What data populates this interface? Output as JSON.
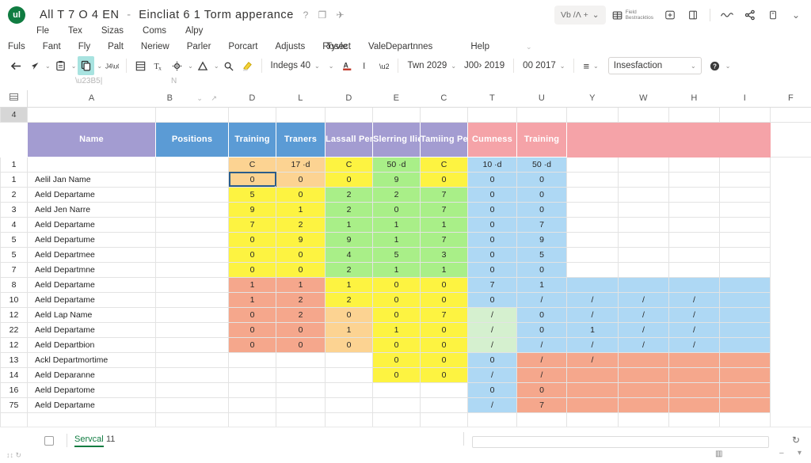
{
  "titlebar": {
    "logo_text": "ul",
    "doc_title_main": "All T 7 O 4 EN",
    "separator": "-",
    "doc_title_sub": "Eincliat 6 1 Torm apperance",
    "title_mini_1": "?",
    "title_mini_2": "❐",
    "title_mini_3": "✈",
    "right": {
      "pill_label": "Vb /Ʌ +",
      "pill_caret": "⌄",
      "field_label_line1": "Field",
      "field_label_line2": "Bestracktios",
      "share_label": "",
      "collapse_caret": "⌄"
    }
  },
  "menu": {
    "row_a": [
      "Fle",
      "Tex",
      "Sizas",
      "Coms",
      "Alpy"
    ],
    "row_b": [
      "Fuls",
      "Fant",
      "Fly",
      "Palt",
      "Neriew",
      "Parler",
      "Porcart",
      "Adjusts",
      "Rosect",
      "Vale"
    ],
    "row_c": [
      "Tyvle",
      "Departnnes",
      "Help"
    ],
    "row_c_caret": "⌄"
  },
  "ribbon": {
    "indent_label": "Indegs 40",
    "font_label": "Twn 2029",
    "font_size_label": "J00› 2019",
    "number_label": "00 2017",
    "style_value": "Insesfaction",
    "caret": "⌄",
    "dropdown_caret": "⌄",
    "align_icon": "≡",
    "help_icon": "?"
  },
  "grid": {
    "columns": [
      "A",
      "B",
      "D",
      "L",
      "D",
      "E",
      "C",
      "T",
      "U",
      "Y",
      "W",
      "H",
      "I",
      "F"
    ],
    "selected_row_gutter": "4",
    "banner": [
      {
        "label": "Name",
        "fill": "bn-purple"
      },
      {
        "label": "Positions",
        "fill": "bn-blue"
      },
      {
        "label": "Training",
        "fill": "bn-blue"
      },
      {
        "label": "Traners",
        "fill": "bn-blue"
      },
      {
        "label": "Lassall Period",
        "fill": "bn-purple"
      },
      {
        "label": "Slerring Ilies",
        "fill": "bn-purple"
      },
      {
        "label": "Tamiing Period",
        "fill": "bn-purple"
      },
      {
        "label": "Cumness",
        "fill": "bn-pink"
      },
      {
        "label": "Training",
        "fill": "bn-pink"
      },
      {
        "label": "",
        "fill": "bn-pinkplain"
      },
      {
        "label": "",
        "fill": "bn-pinkplain"
      },
      {
        "label": "",
        "fill": "bn-pinkplain"
      },
      {
        "label": "",
        "fill": "bn-pinkplain"
      },
      {
        "label": "",
        "fill": "bn-none"
      }
    ],
    "rows": [
      {
        "num": "1",
        "name": "",
        "cells": [
          {
            "v": "C",
            "f": "f-orange"
          },
          {
            "v": "17 ·d",
            "f": "f-orange"
          },
          {
            "v": "C",
            "f": "f-yellow"
          },
          {
            "v": "50 ·d",
            "f": "f-green"
          },
          {
            "v": "C",
            "f": "f-yellow"
          },
          {
            "v": "10 ·d",
            "f": "f-blue"
          },
          {
            "v": "50 ·d",
            "f": "f-blue"
          },
          {
            "v": "",
            "f": "f-none"
          },
          {
            "v": "",
            "f": "f-none"
          },
          {
            "v": "",
            "f": "f-none"
          },
          {
            "v": "",
            "f": "f-none"
          }
        ]
      },
      {
        "num": "1",
        "name": "Aelil Jan Name",
        "cells": [
          {
            "v": "0",
            "f": "f-orange",
            "anchor": true
          },
          {
            "v": "0",
            "f": "f-orange"
          },
          {
            "v": "0",
            "f": "f-yellow"
          },
          {
            "v": "9",
            "f": "f-green"
          },
          {
            "v": "0",
            "f": "f-yellow"
          },
          {
            "v": "0",
            "f": "f-blue"
          },
          {
            "v": "0",
            "f": "f-blue"
          },
          {
            "v": "",
            "f": "f-none"
          },
          {
            "v": "",
            "f": "f-none"
          },
          {
            "v": "",
            "f": "f-none"
          },
          {
            "v": "",
            "f": "f-none"
          }
        ]
      },
      {
        "num": "2",
        "name": "Aeld Departame",
        "cells": [
          {
            "v": "5",
            "f": "f-yellow"
          },
          {
            "v": "0",
            "f": "f-yellow"
          },
          {
            "v": "2",
            "f": "f-green"
          },
          {
            "v": "2",
            "f": "f-green"
          },
          {
            "v": "7",
            "f": "f-green"
          },
          {
            "v": "0",
            "f": "f-blue"
          },
          {
            "v": "0",
            "f": "f-blue"
          },
          {
            "v": "",
            "f": "f-none"
          },
          {
            "v": "",
            "f": "f-none"
          },
          {
            "v": "",
            "f": "f-none"
          },
          {
            "v": "",
            "f": "f-none"
          }
        ]
      },
      {
        "num": "3",
        "name": "Aeld Jen Narre",
        "cells": [
          {
            "v": "9",
            "f": "f-yellow"
          },
          {
            "v": "1",
            "f": "f-yellow"
          },
          {
            "v": "2",
            "f": "f-green"
          },
          {
            "v": "0",
            "f": "f-green"
          },
          {
            "v": "7",
            "f": "f-green"
          },
          {
            "v": "0",
            "f": "f-blue"
          },
          {
            "v": "0",
            "f": "f-blue"
          },
          {
            "v": "",
            "f": "f-none"
          },
          {
            "v": "",
            "f": "f-none"
          },
          {
            "v": "",
            "f": "f-none"
          },
          {
            "v": "",
            "f": "f-none"
          }
        ]
      },
      {
        "num": "4",
        "name": "Aeld Departame",
        "cells": [
          {
            "v": "7",
            "f": "f-yellow"
          },
          {
            "v": "2",
            "f": "f-yellow"
          },
          {
            "v": "1",
            "f": "f-green"
          },
          {
            "v": "1",
            "f": "f-green"
          },
          {
            "v": "1",
            "f": "f-green"
          },
          {
            "v": "0",
            "f": "f-blue"
          },
          {
            "v": "7",
            "f": "f-blue"
          },
          {
            "v": "",
            "f": "f-none"
          },
          {
            "v": "",
            "f": "f-none"
          },
          {
            "v": "",
            "f": "f-none"
          },
          {
            "v": "",
            "f": "f-none"
          }
        ]
      },
      {
        "num": "5",
        "name": "Aeld Departume",
        "cells": [
          {
            "v": "0",
            "f": "f-yellow"
          },
          {
            "v": "9",
            "f": "f-yellow"
          },
          {
            "v": "9",
            "f": "f-green"
          },
          {
            "v": "1",
            "f": "f-green"
          },
          {
            "v": "7",
            "f": "f-green"
          },
          {
            "v": "0",
            "f": "f-blue"
          },
          {
            "v": "9",
            "f": "f-blue"
          },
          {
            "v": "",
            "f": "f-none"
          },
          {
            "v": "",
            "f": "f-none"
          },
          {
            "v": "",
            "f": "f-none"
          },
          {
            "v": "",
            "f": "f-none"
          }
        ]
      },
      {
        "num": "5",
        "name": "Aeld Departmee",
        "cells": [
          {
            "v": "0",
            "f": "f-yellow"
          },
          {
            "v": "0",
            "f": "f-yellow"
          },
          {
            "v": "4",
            "f": "f-green"
          },
          {
            "v": "5",
            "f": "f-green"
          },
          {
            "v": "3",
            "f": "f-green"
          },
          {
            "v": "0",
            "f": "f-blue"
          },
          {
            "v": "5",
            "f": "f-blue"
          },
          {
            "v": "",
            "f": "f-none"
          },
          {
            "v": "",
            "f": "f-none"
          },
          {
            "v": "",
            "f": "f-none"
          },
          {
            "v": "",
            "f": "f-none"
          }
        ]
      },
      {
        "num": "7",
        "name": "Aeld Departmne",
        "cells": [
          {
            "v": "0",
            "f": "f-yellow"
          },
          {
            "v": "0",
            "f": "f-yellow"
          },
          {
            "v": "2",
            "f": "f-green"
          },
          {
            "v": "1",
            "f": "f-green"
          },
          {
            "v": "1",
            "f": "f-green"
          },
          {
            "v": "0",
            "f": "f-blue"
          },
          {
            "v": "0",
            "f": "f-blue"
          },
          {
            "v": "",
            "f": "f-none"
          },
          {
            "v": "",
            "f": "f-none"
          },
          {
            "v": "",
            "f": "f-none"
          },
          {
            "v": "",
            "f": "f-none"
          }
        ]
      },
      {
        "num": "8",
        "name": "Aeld Departame",
        "cells": [
          {
            "v": "1",
            "f": "f-salmon"
          },
          {
            "v": "1",
            "f": "f-salmon"
          },
          {
            "v": "1",
            "f": "f-yellow"
          },
          {
            "v": "0",
            "f": "f-yellow"
          },
          {
            "v": "0",
            "f": "f-yellow"
          },
          {
            "v": "7",
            "f": "f-blue"
          },
          {
            "v": "1",
            "f": "f-blue"
          },
          {
            "v": "",
            "f": "f-blue"
          },
          {
            "v": "",
            "f": "f-blue"
          },
          {
            "v": "",
            "f": "f-blue"
          },
          {
            "v": "",
            "f": "f-blue"
          }
        ]
      },
      {
        "num": "10",
        "name": "Aeld Departame",
        "cells": [
          {
            "v": "1",
            "f": "f-salmon"
          },
          {
            "v": "2",
            "f": "f-salmon"
          },
          {
            "v": "2",
            "f": "f-yellow"
          },
          {
            "v": "0",
            "f": "f-yellow"
          },
          {
            "v": "0",
            "f": "f-yellow"
          },
          {
            "v": "0",
            "f": "f-blue"
          },
          {
            "v": "/",
            "f": "f-blue"
          },
          {
            "v": "/",
            "f": "f-blue"
          },
          {
            "v": "/",
            "f": "f-blue"
          },
          {
            "v": "/",
            "f": "f-blue"
          },
          {
            "v": "",
            "f": "f-blue"
          }
        ]
      },
      {
        "num": "12",
        "name": "Aeld Lap Name",
        "cells": [
          {
            "v": "0",
            "f": "f-salmon"
          },
          {
            "v": "2",
            "f": "f-salmon"
          },
          {
            "v": "0",
            "f": "f-orange"
          },
          {
            "v": "0",
            "f": "f-yellow"
          },
          {
            "v": "7",
            "f": "f-yellow"
          },
          {
            "v": "/",
            "f": "f-mint"
          },
          {
            "v": "0",
            "f": "f-blue"
          },
          {
            "v": "/",
            "f": "f-blue"
          },
          {
            "v": "/",
            "f": "f-blue"
          },
          {
            "v": "/",
            "f": "f-blue"
          },
          {
            "v": "",
            "f": "f-blue"
          }
        ]
      },
      {
        "num": "22",
        "name": "Aeld Departame",
        "cells": [
          {
            "v": "0",
            "f": "f-salmon"
          },
          {
            "v": "0",
            "f": "f-salmon"
          },
          {
            "v": "1",
            "f": "f-orange"
          },
          {
            "v": "1",
            "f": "f-yellow"
          },
          {
            "v": "0",
            "f": "f-yellow"
          },
          {
            "v": "/",
            "f": "f-mint"
          },
          {
            "v": "0",
            "f": "f-blue"
          },
          {
            "v": "1",
            "f": "f-blue"
          },
          {
            "v": "/",
            "f": "f-blue"
          },
          {
            "v": "/",
            "f": "f-blue"
          },
          {
            "v": "",
            "f": "f-blue"
          }
        ]
      },
      {
        "num": "12",
        "name": "Aeld Departbion",
        "cells": [
          {
            "v": "0",
            "f": "f-salmon"
          },
          {
            "v": "0",
            "f": "f-salmon"
          },
          {
            "v": "0",
            "f": "f-orange"
          },
          {
            "v": "0",
            "f": "f-yellow"
          },
          {
            "v": "0",
            "f": "f-yellow"
          },
          {
            "v": "/",
            "f": "f-mint"
          },
          {
            "v": "/",
            "f": "f-blue"
          },
          {
            "v": "/",
            "f": "f-blue"
          },
          {
            "v": "/",
            "f": "f-blue"
          },
          {
            "v": "/",
            "f": "f-blue"
          },
          {
            "v": "",
            "f": "f-blue"
          }
        ]
      },
      {
        "num": "13",
        "name": "Ackl Departmortime",
        "cells": [
          {
            "v": "",
            "f": "f-none"
          },
          {
            "v": "",
            "f": "f-none"
          },
          {
            "v": "",
            "f": "f-none"
          },
          {
            "v": "0",
            "f": "f-yellow"
          },
          {
            "v": "0",
            "f": "f-yellow"
          },
          {
            "v": "0",
            "f": "f-blue"
          },
          {
            "v": "/",
            "f": "f-salmon"
          },
          {
            "v": "/",
            "f": "f-salmon"
          },
          {
            "v": "",
            "f": "f-salmon"
          },
          {
            "v": "",
            "f": "f-salmon"
          },
          {
            "v": "",
            "f": "f-salmon"
          }
        ]
      },
      {
        "num": "14",
        "name": "Aeld Deparanne",
        "cells": [
          {
            "v": "",
            "f": "f-none"
          },
          {
            "v": "",
            "f": "f-none"
          },
          {
            "v": "",
            "f": "f-none"
          },
          {
            "v": "0",
            "f": "f-yellow"
          },
          {
            "v": "0",
            "f": "f-yellow"
          },
          {
            "v": "/",
            "f": "f-blue"
          },
          {
            "v": "/",
            "f": "f-salmon"
          },
          {
            "v": "",
            "f": "f-salmon"
          },
          {
            "v": "",
            "f": "f-salmon"
          },
          {
            "v": "",
            "f": "f-salmon"
          },
          {
            "v": "",
            "f": "f-salmon"
          }
        ]
      },
      {
        "num": "16",
        "name": "Aeld Departome",
        "cells": [
          {
            "v": "",
            "f": "f-none"
          },
          {
            "v": "",
            "f": "f-none"
          },
          {
            "v": "",
            "f": "f-none"
          },
          {
            "v": "",
            "f": "f-none"
          },
          {
            "v": "",
            "f": "f-none"
          },
          {
            "v": "0",
            "f": "f-blue"
          },
          {
            "v": "0",
            "f": "f-salmon"
          },
          {
            "v": "",
            "f": "f-salmon"
          },
          {
            "v": "",
            "f": "f-salmon"
          },
          {
            "v": "",
            "f": "f-salmon"
          },
          {
            "v": "",
            "f": "f-salmon"
          }
        ]
      },
      {
        "num": "75",
        "name": "Aeld Departame",
        "cells": [
          {
            "v": "",
            "f": "f-none"
          },
          {
            "v": "",
            "f": "f-none"
          },
          {
            "v": "",
            "f": "f-none"
          },
          {
            "v": "",
            "f": "f-none"
          },
          {
            "v": "",
            "f": "f-none"
          },
          {
            "v": "/",
            "f": "f-blue"
          },
          {
            "v": "7",
            "f": "f-salmon"
          },
          {
            "v": "",
            "f": "f-salmon"
          },
          {
            "v": "",
            "f": "f-salmon"
          },
          {
            "v": "",
            "f": "f-salmon"
          },
          {
            "v": "",
            "f": "f-salmon"
          }
        ]
      },
      {
        "num": "",
        "name": "",
        "cells": [
          {
            "v": "",
            "f": "f-none"
          },
          {
            "v": "",
            "f": "f-none"
          },
          {
            "v": "",
            "f": "f-none"
          },
          {
            "v": "",
            "f": "f-none"
          },
          {
            "v": "",
            "f": "f-none"
          },
          {
            "v": "",
            "f": "f-none"
          },
          {
            "v": "",
            "f": "f-none"
          },
          {
            "v": "",
            "f": "f-none"
          },
          {
            "v": "",
            "f": "f-none"
          },
          {
            "v": "",
            "f": "f-none"
          },
          {
            "v": "",
            "f": "f-none"
          }
        ]
      }
    ]
  },
  "statusbar": {
    "sheet_tab": "Servcal",
    "sheet_num": "11",
    "left_mini": "↕↕ ↻",
    "reload_icon": "↻",
    "chart_icon": "▥",
    "minus_icon": "−",
    "down_icon": "▾",
    "up_arrow": "↑"
  }
}
